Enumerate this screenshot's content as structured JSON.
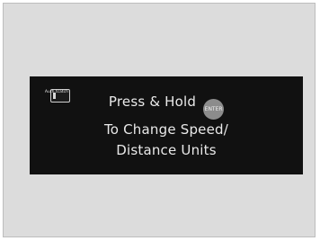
{
  "display": {
    "mode_icon": {
      "name": "info-display-mode-icon",
      "label": "Auth tcatch"
    },
    "message": {
      "line1_prefix": "Press & Hold",
      "enter_button_label": "ENTER",
      "line2": "To Change Speed/",
      "line3": "Distance Units"
    }
  }
}
